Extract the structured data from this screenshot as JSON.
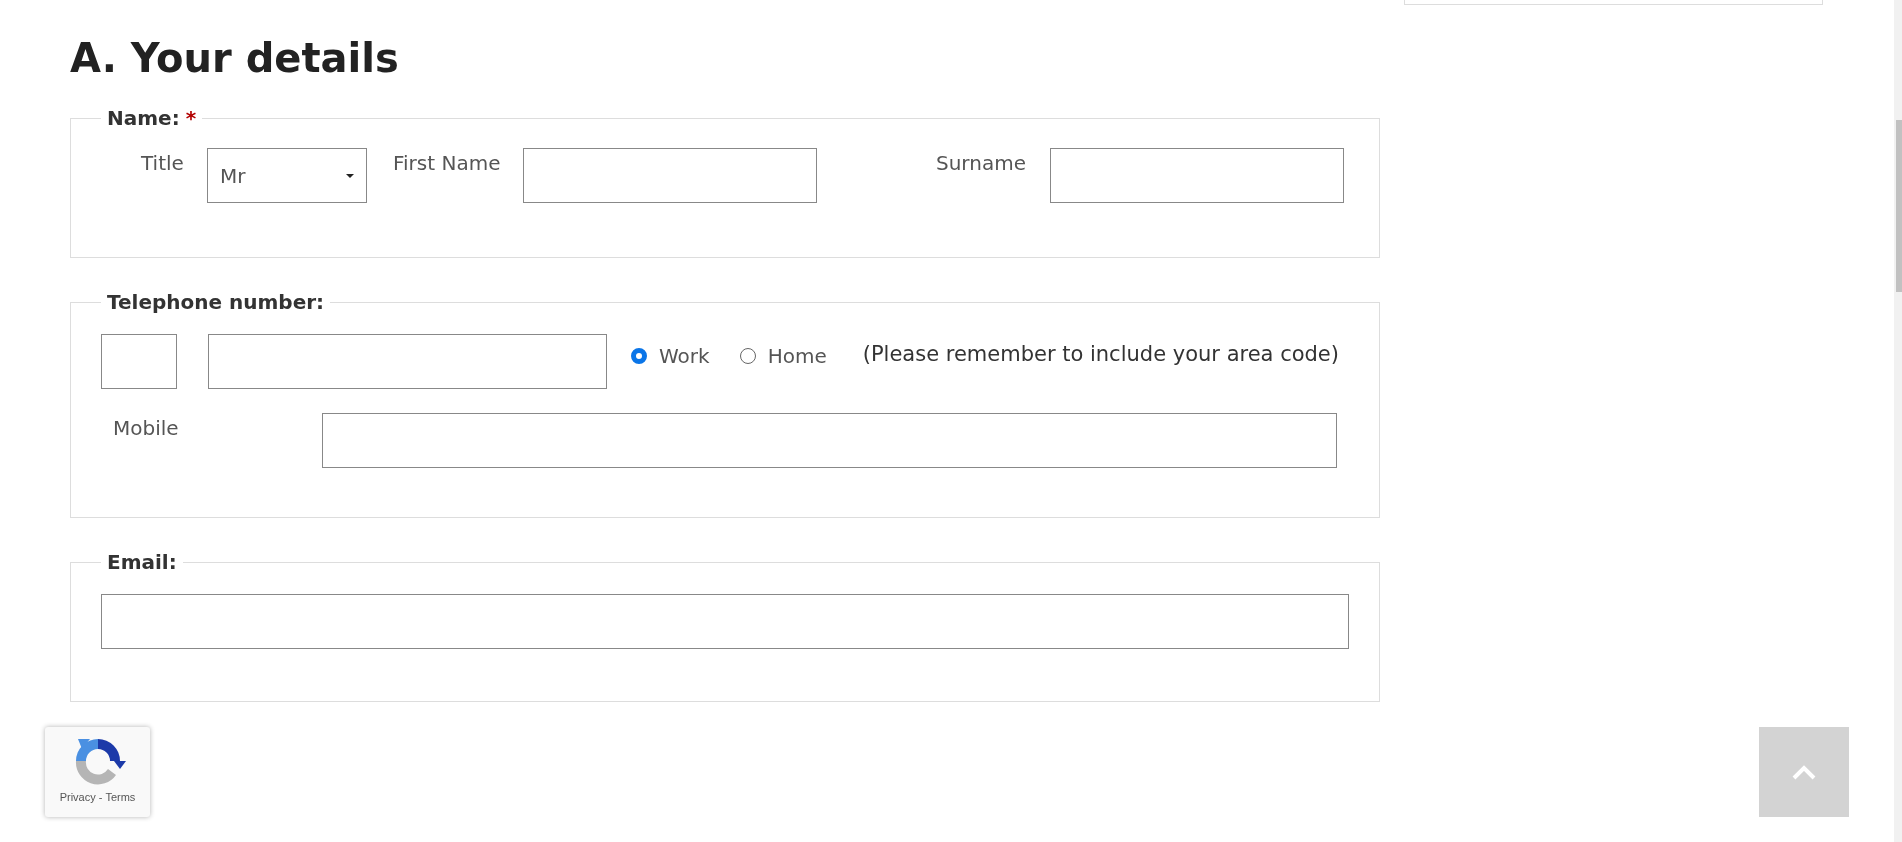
{
  "heading": "A. Your details",
  "name_group": {
    "legend": "Name:",
    "required_mark": "*",
    "title": {
      "label": "Title",
      "value": "Mr"
    },
    "first_name": {
      "label": "First Name"
    },
    "surname": {
      "label": "Surname"
    }
  },
  "telephone_group": {
    "legend": "Telephone number:",
    "type_options": [
      {
        "label": "Work",
        "selected": true
      },
      {
        "label": "Home",
        "selected": false
      }
    ],
    "note": "(Please remember to include your area code)",
    "mobile": {
      "label": "Mobile"
    }
  },
  "email_group": {
    "legend": "Email:"
  },
  "recaptcha": {
    "privacy_link": "Privacy",
    "separator": "-",
    "terms_link": "Terms"
  }
}
